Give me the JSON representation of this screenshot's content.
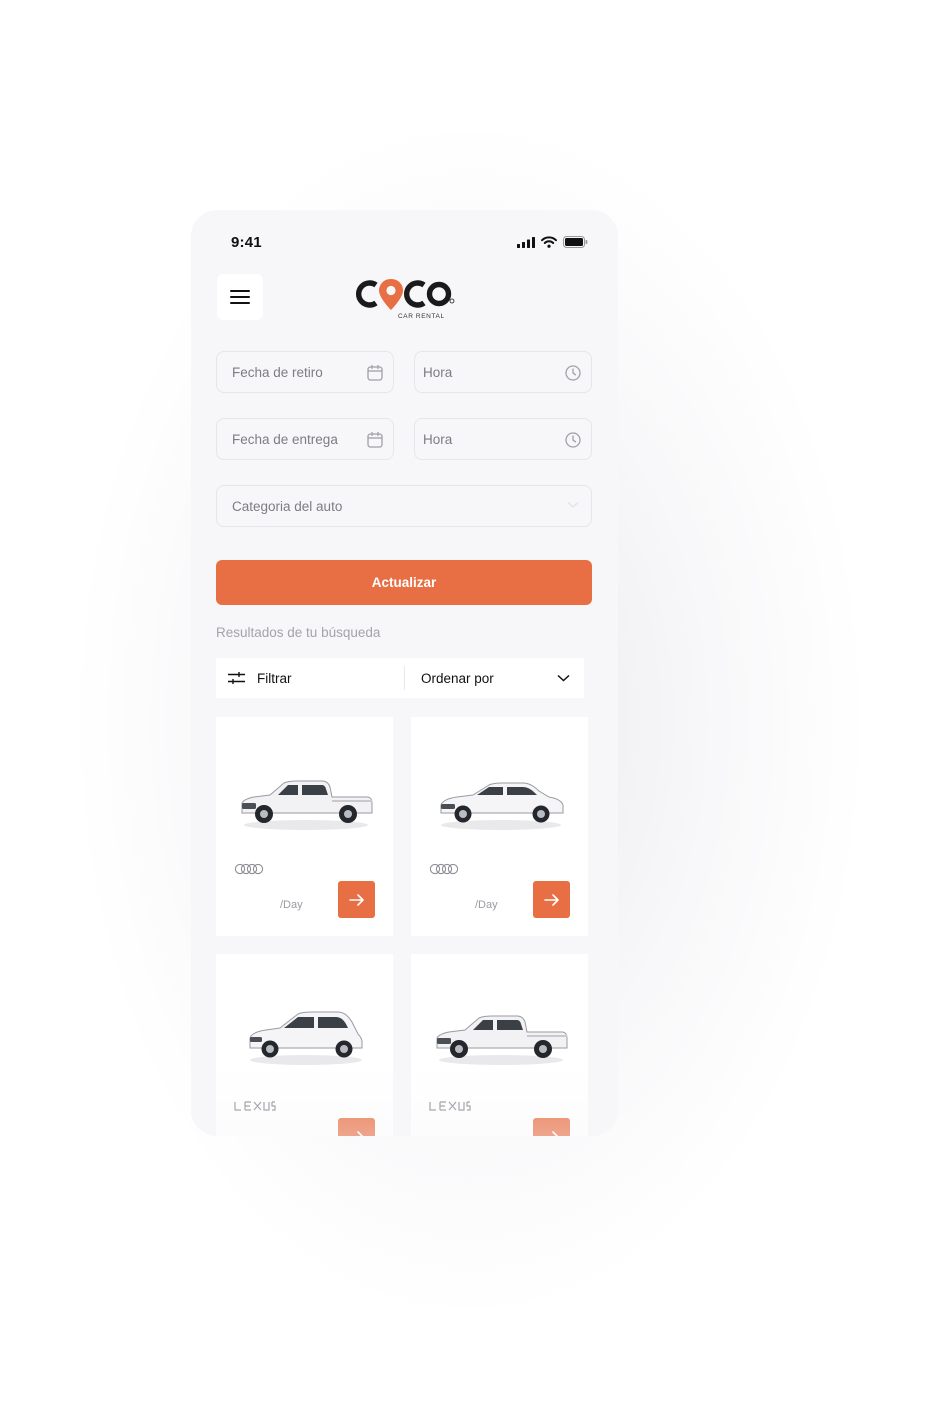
{
  "status_bar": {
    "time": "9:41",
    "icons": [
      "signal-icon",
      "wifi-icon",
      "battery-icon"
    ]
  },
  "header": {
    "menu_icon": "menu-icon",
    "logo_text": "COCO",
    "logo_tagline": "CAR RENTAL"
  },
  "search": {
    "pickup_date": {
      "placeholder": "Fecha de retiro",
      "icon": "calendar-icon"
    },
    "pickup_time": {
      "placeholder": "Hora",
      "icon": "clock-icon"
    },
    "return_date": {
      "placeholder": "Fecha de entrega",
      "icon": "calendar-icon"
    },
    "return_time": {
      "placeholder": "Hora",
      "icon": "clock-icon"
    },
    "category": {
      "placeholder": "Categoria del auto",
      "icon": "chevron-down-icon"
    },
    "submit_label": "Actualizar"
  },
  "results": {
    "title": "Resultados de tu búsqueda",
    "filter_label": "Filtrar",
    "sort_label": "Ordenar por",
    "cards": [
      {
        "car": "pickup-truck",
        "brand": "audi-logo",
        "price_unit": "/Day"
      },
      {
        "car": "sedan",
        "brand": "audi-logo",
        "price_unit": "/Day"
      },
      {
        "car": "hatchback",
        "brand": "lexus-logo",
        "price_unit": ""
      },
      {
        "car": "pickup-truck",
        "brand": "lexus-logo",
        "price_unit": ""
      }
    ]
  },
  "colors": {
    "accent": "#E86F44",
    "background": "#F7F7F9",
    "card": "#FFFFFF",
    "muted_text": "#A3A3AB"
  }
}
